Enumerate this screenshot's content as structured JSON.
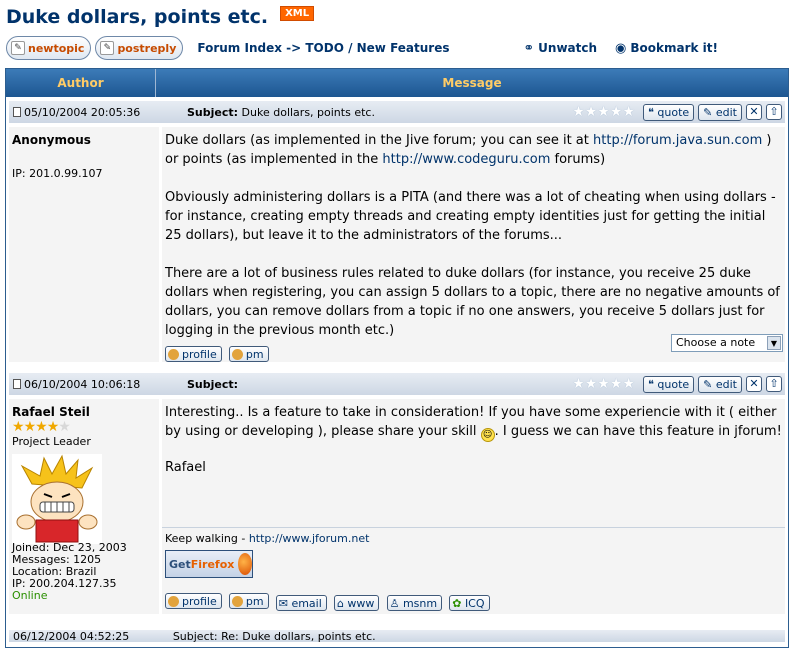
{
  "page": {
    "title": "Duke dollars, points etc.",
    "xml_badge": "XML"
  },
  "nav": {
    "new_topic_label": "newtopic",
    "post_reply_label": "postreply",
    "breadcrumb": "Forum Index -> TODO / New Features",
    "unwatch_label": "Unwatch",
    "bookmark_label": "Bookmark it!"
  },
  "table": {
    "author_header": "Author",
    "message_header": "Message"
  },
  "post_tools": {
    "quote_label": "quote",
    "edit_label": "edit",
    "delete_icon": "✕",
    "top_icon": "⇧",
    "profile_label": "profile",
    "pm_label": "pm",
    "email_label": "email",
    "www_label": "www",
    "msnm_label": "msnm",
    "icq_label": "ICQ",
    "subject_label": "Subject:"
  },
  "posts": [
    {
      "date": "05/10/2004 20:05:36",
      "subject": "Duke dollars, points etc.",
      "author": "Anonymous",
      "ip": "IP: 201.0.99.107",
      "para1_a": "Duke dollars (as implemented in the Jive forum; you can see it at ",
      "para1_link1": "http://forum.java.sun.com",
      "para1_b": " ) or points (as implemented in the ",
      "para1_link2": "http://www.codeguru.com",
      "para1_c": " forums)",
      "para2": "Obviously administering dollars is a PITA (and there was a lot of cheating when using dollars - for instance, creating empty threads and creating empty identities just for getting the initial 25 dollars), but leave it to the administrators of the forums...",
      "para3": "There are a lot of business rules related to duke dollars (for instance, you receive 25 duke dollars when registering, you can assign 5 dollars to a topic, there are no negative amounts of dollars, you can remove dollars from a topic if no one answers, you receive 5 dollars just for logging in the previous month etc.)",
      "note_select": "Choose a note"
    },
    {
      "date": "06/10/2004 10:06:18",
      "subject": "",
      "author": "Rafael Steil",
      "rank": "Project Leader",
      "rank_stars": 4,
      "para1_a": "Interesting.. Is a feature to take in consideration! If you have some experiencie with it ( either by using or developing ), please share your skill ",
      "para1_b": ". I guess we can have this feature in jforum!",
      "para2": "Rafael",
      "signature_text": "Keep walking - ",
      "signature_link": "http://www.jforum.net",
      "firefox_label_a": "Get",
      "firefox_label_b": "Firefox",
      "joined": "Joined: Dec 23, 2003",
      "messages": "Messages: 1205",
      "location": "Location: Brazil",
      "ip": "IP: 200.204.127.35",
      "status": "Online"
    },
    {
      "date": "06/12/2004 04:52:25",
      "subject": "Re: Duke dollars, points etc."
    }
  ]
}
